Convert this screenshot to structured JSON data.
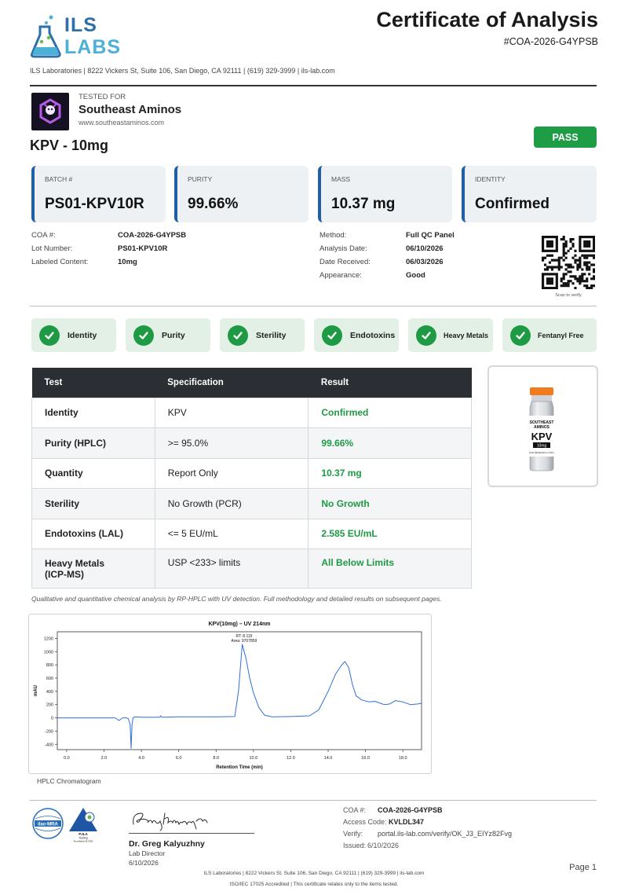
{
  "header": {
    "logo_top": "ILS",
    "logo_bottom": "LABS",
    "title": "Certificate of Analysis",
    "coa_ref": "#COA-2026-G4YPSB",
    "address": "ILS Laboratories  |  8222 Vickers St, Suite 106, San Diego, CA 92111  |  (619) 329-3999  |  ils-lab.com"
  },
  "client": {
    "tested_for": "TESTED FOR",
    "name": "Southeast Aminos",
    "url": "www.southeastaminos.com"
  },
  "product": "KPV - 10mg",
  "status": "PASS",
  "cards": [
    {
      "label": "BATCH #",
      "value": "PS01-KPV10R"
    },
    {
      "label": "PURITY",
      "value": "99.66%"
    },
    {
      "label": "MASS",
      "value": "10.37 mg"
    },
    {
      "label": "IDENTITY",
      "value": "Confirmed"
    }
  ],
  "details_left": [
    {
      "k": "COA #:",
      "v": "COA-2026-G4YPSB"
    },
    {
      "k": "Lot Number:",
      "v": "PS01-KPV10R"
    },
    {
      "k": "Labeled Content:",
      "v": "10mg"
    }
  ],
  "details_right": [
    {
      "k": "Method:",
      "v": "Full QC Panel"
    },
    {
      "k": "Analysis Date:",
      "v": "06/10/2026"
    },
    {
      "k": "Date Received:",
      "v": "06/03/2026"
    },
    {
      "k": "Appearance:",
      "v": "Good"
    }
  ],
  "qr_caption": "Scan to verify",
  "chips": [
    "Identity",
    "Purity",
    "Sterility",
    "Endotoxins",
    "Heavy Metals",
    "Fentanyl Free"
  ],
  "table": {
    "headers": [
      "Test",
      "Specification",
      "Result"
    ],
    "rows": [
      {
        "test": "Identity",
        "spec": "KPV",
        "result": "Confirmed"
      },
      {
        "test": "Purity (HPLC)",
        "spec": ">= 95.0%",
        "result": "99.66%"
      },
      {
        "test": "Quantity",
        "spec": "Report Only",
        "result": "10.37 mg"
      },
      {
        "test": "Sterility",
        "spec": "No Growth (PCR)",
        "result": "No Growth"
      },
      {
        "test": "Endotoxins (LAL)",
        "spec": "<= 5 EU/mL",
        "result": "2.585 EU/mL"
      },
      {
        "test": "Heavy Metals",
        "test2": "(ICP-MS)",
        "spec": "USP <233> limits",
        "result": "All Below Limits"
      }
    ]
  },
  "vial": {
    "brand1": "SOUTHEAST",
    "brand2": "AMINOS",
    "name": "KPV",
    "dose": "10mg",
    "fine": "FOR RESEARCH ONLY"
  },
  "note": "Qualitative and quantitative chemical analysis by RP-HPLC with UV detection. Full methodology and detailed results on subsequent pages.",
  "chart_data": {
    "type": "line",
    "title": "KPV(10mg) – UV 214nm",
    "xlabel": "Retention Time (min)",
    "ylabel": "mAU",
    "xlim": [
      -0.5,
      19.0
    ],
    "ylim": [
      -480,
      1300
    ],
    "xticks": [
      0.0,
      2.0,
      4.0,
      6.0,
      8.0,
      10.0,
      12.0,
      14.0,
      16.0,
      18.0
    ],
    "yticks": [
      -400,
      -200,
      0,
      200,
      400,
      600,
      800,
      1000,
      1200
    ],
    "annotation": {
      "line1": "RT: 8.115",
      "line2": "Area: 9707859",
      "x": 9.5,
      "y": 1110
    },
    "series": [
      {
        "color": "#2f6fd6",
        "x": [
          -0.5,
          2.0,
          2.6,
          2.8,
          3.0,
          3.2,
          3.3,
          3.4,
          3.45,
          3.5,
          3.55,
          3.6,
          3.7,
          4.0,
          4.4,
          5.0,
          5.03,
          5.1,
          6.0,
          8.0,
          9.0,
          9.2,
          9.4,
          9.6,
          9.8,
          10.0,
          10.3,
          10.6,
          11.0,
          12.0,
          13.0,
          13.5,
          14.0,
          14.4,
          14.7,
          14.9,
          15.1,
          15.3,
          15.5,
          15.8,
          16.2,
          16.5,
          16.8,
          17.0,
          17.3,
          17.6,
          18.0,
          18.4,
          18.8,
          19.0
        ],
        "y": [
          0,
          0,
          0,
          -40,
          0,
          0,
          -10,
          -100,
          -460,
          -100,
          0,
          10,
          15,
          10,
          10,
          10,
          30,
          10,
          15,
          15,
          20,
          400,
          1110,
          900,
          600,
          380,
          150,
          40,
          15,
          20,
          30,
          120,
          400,
          660,
          790,
          850,
          760,
          500,
          330,
          270,
          240,
          250,
          220,
          200,
          210,
          260,
          240,
          200,
          210,
          220
        ]
      }
    ]
  },
  "chart_caption": "HPLC Chromatogram",
  "signature": {
    "script": "Greg Kalyuzhny",
    "name": "Dr. Greg Kalyuzhny",
    "role": "Lab Director",
    "date": "6/10/2026"
  },
  "accred": {
    "left": "ilac-MRA",
    "right": "PJLA",
    "right_sub": "Testing",
    "right_num": "Accreditation #117382"
  },
  "verify": [
    {
      "k": "COA #:",
      "v": "COA-2026-G4YPSB"
    },
    {
      "k": "Access Code:",
      "v": "KVLDL347"
    },
    {
      "k": "Verify:",
      "v": "portal.ils-lab.com/verify/OK_J3_EIYz82Fvg"
    },
    {
      "k": "Issued:",
      "v": "6/10/2026"
    }
  ],
  "page": "Page 1",
  "footer1": "ILS Laboratories  |  8222 Vickers St, Suite 106, San Diego, CA 92111  |  (619) 329-3999  |  ils-lab.com",
  "footer2": "ISO/IEC 17025 Accredited  |  This certificate relates only to the items tested.",
  "colors": {
    "accent": "#1f5fa8",
    "pass": "#1f9d46",
    "chart_line": "#2f6fd6"
  }
}
